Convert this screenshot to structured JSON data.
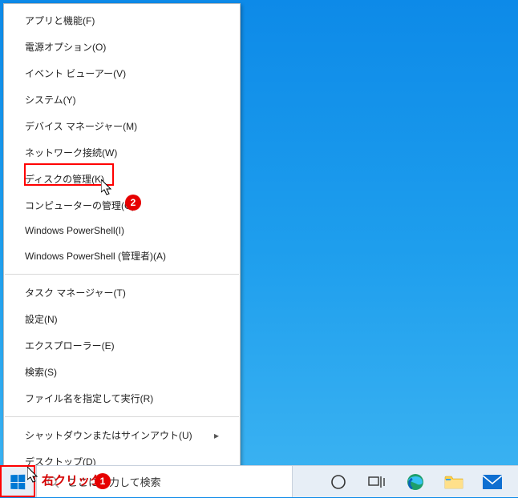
{
  "menu": {
    "groups": [
      {
        "items": [
          {
            "key": "apps-features",
            "label": "アプリと機能(F)"
          },
          {
            "key": "power-options",
            "label": "電源オプション(O)"
          },
          {
            "key": "event-viewer",
            "label": "イベント ビューアー(V)"
          },
          {
            "key": "system",
            "label": "システム(Y)"
          },
          {
            "key": "device-manager",
            "label": "デバイス マネージャー(M)"
          },
          {
            "key": "network-conn",
            "label": "ネットワーク接続(W)"
          },
          {
            "key": "disk-mgmt",
            "label": "ディスクの管理(K)",
            "highlighted": true
          },
          {
            "key": "computer-mgmt",
            "label": "コンピューターの管理(G)"
          },
          {
            "key": "powershell",
            "label": "Windows PowerShell(I)"
          },
          {
            "key": "powershell-admin",
            "label": "Windows PowerShell (管理者)(A)"
          }
        ]
      },
      {
        "items": [
          {
            "key": "task-manager",
            "label": "タスク マネージャー(T)"
          },
          {
            "key": "settings",
            "label": "設定(N)"
          },
          {
            "key": "explorer",
            "label": "エクスプローラー(E)"
          },
          {
            "key": "search-menu",
            "label": "検索(S)"
          },
          {
            "key": "run",
            "label": "ファイル名を指定して実行(R)"
          }
        ]
      },
      {
        "items": [
          {
            "key": "shutdown-signout",
            "label": "シャットダウンまたはサインアウト(U)",
            "submenu": true
          },
          {
            "key": "desktop",
            "label": "デスクトップ(D)"
          }
        ]
      }
    ]
  },
  "taskbar": {
    "search_placeholder": "ここに入力して検索"
  },
  "annotations": {
    "start_label": "右クリック",
    "badge1": "1",
    "badge2": "2"
  }
}
